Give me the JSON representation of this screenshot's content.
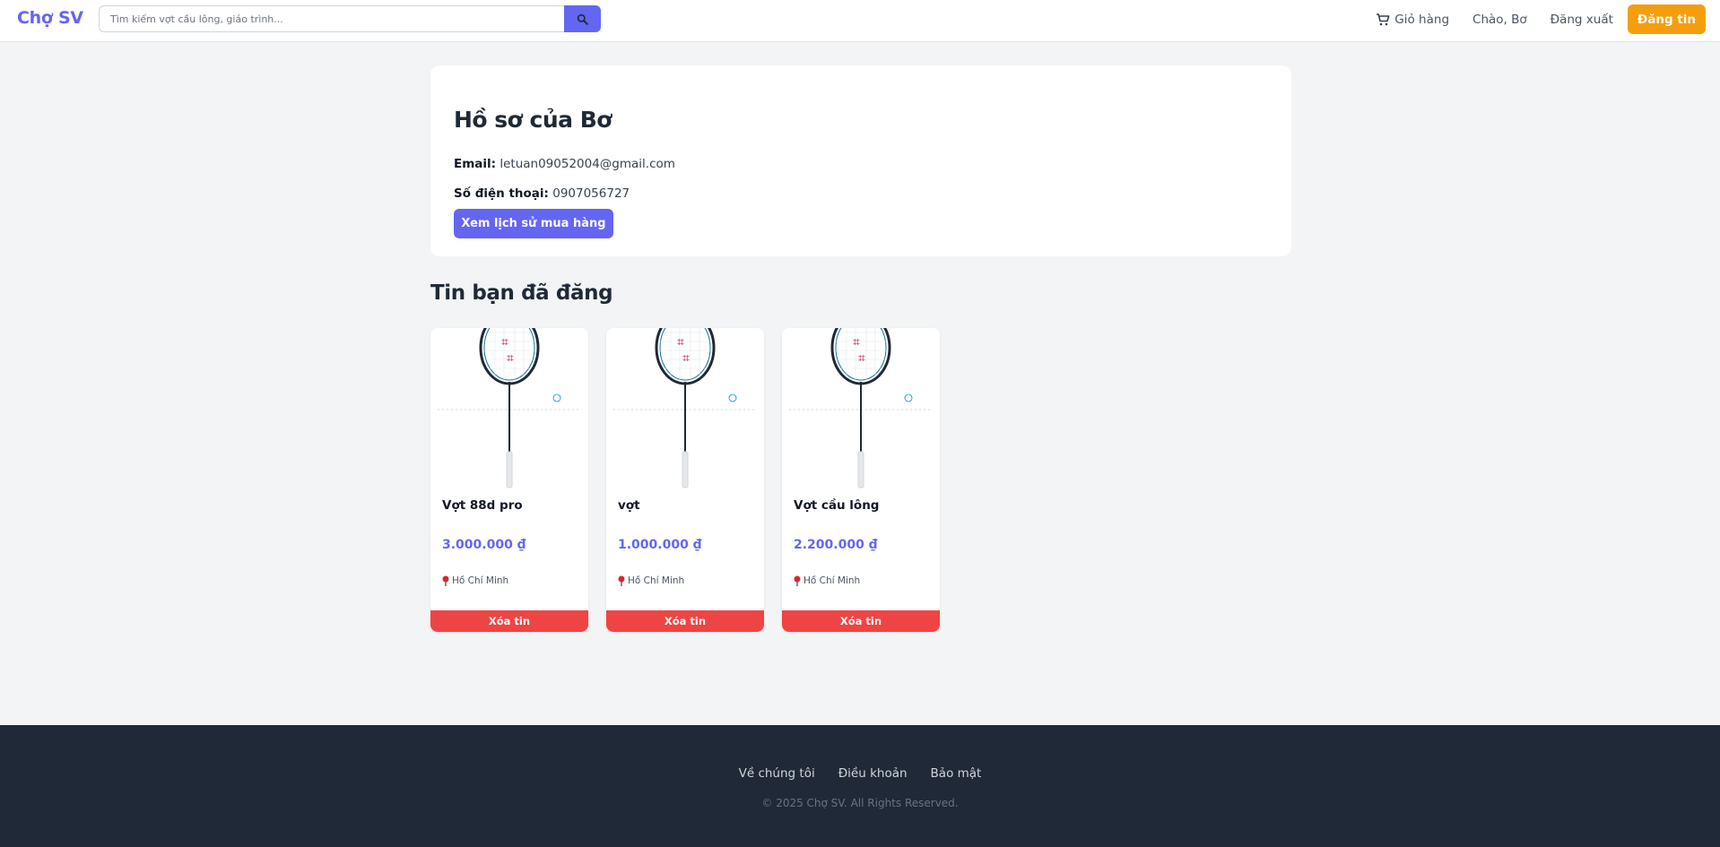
{
  "header": {
    "logo": "Chợ SV",
    "search_placeholder": "Tìm kiếm vợt cầu lông, giáo trình...",
    "nav": {
      "cart_label": "Giỏ hàng",
      "greeting": "Chào, Bơ",
      "logout_label": "Đăng xuất",
      "post_label": "Đăng tin"
    }
  },
  "profile": {
    "title": "Hồ sơ của Bơ",
    "email_label": "Email:",
    "email": "letuan09052004@gmail.com",
    "phone_label": "Số điện thoại:",
    "phone": "0907056727",
    "history_button": "Xem lịch sử mua hàng"
  },
  "section_title": "Tin bạn đã đăng",
  "listings": [
    {
      "title": "Vợt 88d pro",
      "price": "3.000.000 ₫",
      "location": "Hồ Chí Minh",
      "delete_label": "Xóa tin"
    },
    {
      "title": "vợt",
      "price": "1.000.000 ₫",
      "location": "Hồ Chí Minh",
      "delete_label": "Xóa tin"
    },
    {
      "title": "Vợt cầu lông",
      "price": "2.200.000 ₫",
      "location": "Hồ Chí Minh",
      "delete_label": "Xóa tin"
    }
  ],
  "footer": {
    "links": [
      "Về chúng tôi",
      "Điều khoản",
      "Bảo mật"
    ],
    "copyright": "© 2025 Chợ SV. All Rights Reserved."
  },
  "icons": {
    "search": "search-icon",
    "cart": "cart-icon",
    "location": "location-pin-icon"
  },
  "colors": {
    "primary": "#6366f1",
    "accent": "#f59e0b",
    "danger": "#ef4444",
    "footer_bg": "#1f2937"
  }
}
